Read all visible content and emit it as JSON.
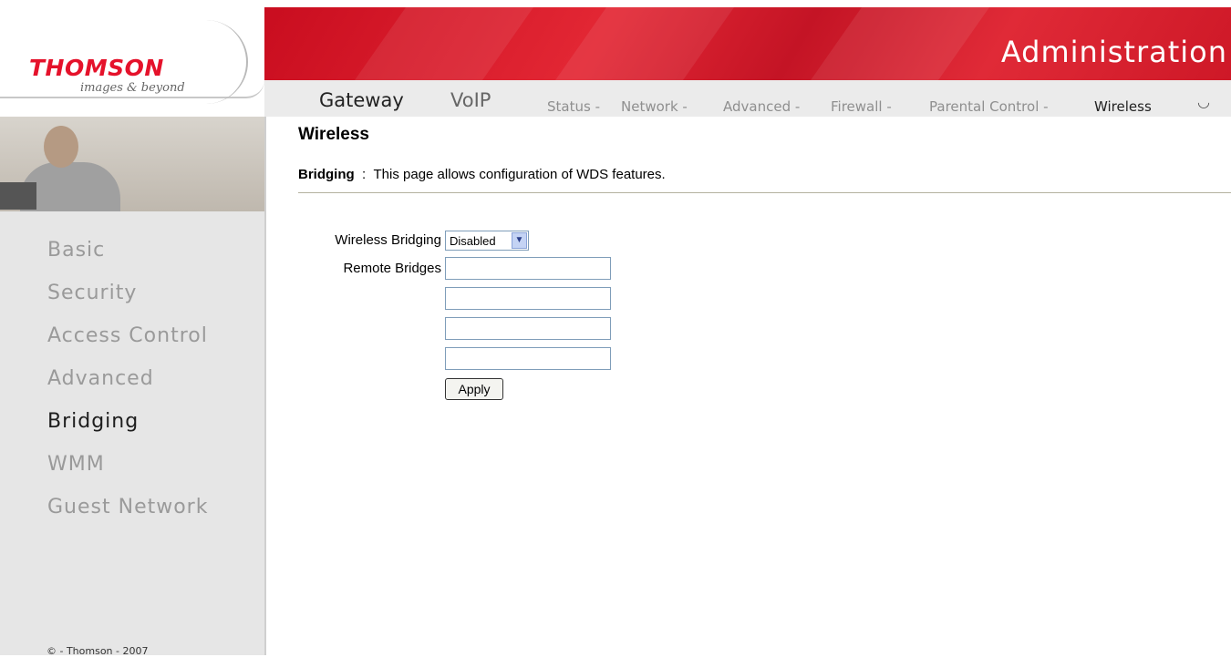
{
  "logo": {
    "brand": "THOMSON",
    "tagline": "images & beyond"
  },
  "header": {
    "title": "Administration"
  },
  "top_nav": {
    "primary": [
      {
        "label": "Gateway",
        "active": true
      },
      {
        "label": "VoIP",
        "active": false
      }
    ],
    "secondary": [
      {
        "label": "Status -",
        "active": false
      },
      {
        "label": "Network -",
        "active": false
      },
      {
        "label": "Advanced -",
        "active": false
      },
      {
        "label": "Firewall -",
        "active": false
      },
      {
        "label": "Parental Control -",
        "active": false
      },
      {
        "label": "Wireless",
        "active": true
      }
    ]
  },
  "sidebar": {
    "items": [
      {
        "label": "Basic",
        "active": false
      },
      {
        "label": "Security",
        "active": false
      },
      {
        "label": "Access Control",
        "active": false
      },
      {
        "label": "Advanced",
        "active": false
      },
      {
        "label": "Bridging",
        "active": true
      },
      {
        "label": "WMM",
        "active": false
      },
      {
        "label": "Guest Network",
        "active": false
      }
    ],
    "copyright": "© - Thomson - 2007"
  },
  "main": {
    "title": "Wireless",
    "section": "Bridging",
    "separator": ":",
    "description": "This page allows configuration of WDS features.",
    "form": {
      "wireless_bridging_label": "Wireless Bridging",
      "wireless_bridging_value": "Disabled",
      "remote_bridges_label": "Remote Bridges",
      "remote_bridges": [
        "",
        "",
        "",
        ""
      ],
      "apply_label": "Apply"
    }
  },
  "colors": {
    "brand_red": "#e32734",
    "sidebar_bg": "#e6e6e6",
    "nav_bg": "#ebebeb"
  }
}
